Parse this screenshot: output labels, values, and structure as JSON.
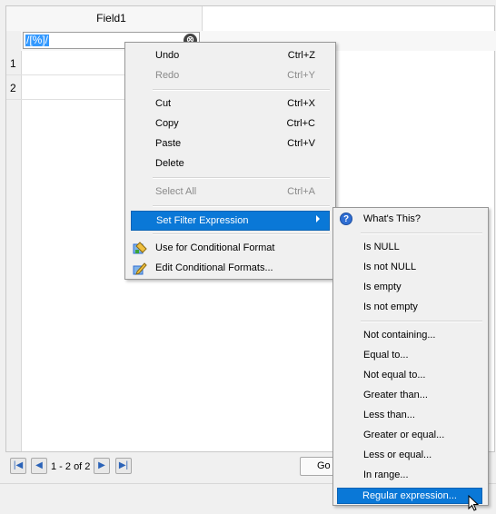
{
  "table": {
    "column_header": "Field1",
    "filter_value": "/[%]/",
    "clear_glyph": "⊗",
    "rows": [
      {
        "number": "1"
      },
      {
        "number": "2"
      }
    ]
  },
  "navigation": {
    "record_label": "1 - 2 of 2",
    "go_label": "Go"
  },
  "context_menu": {
    "undo": {
      "label": "Undo",
      "shortcut": "Ctrl+Z"
    },
    "redo": {
      "label": "Redo",
      "shortcut": "Ctrl+Y"
    },
    "cut": {
      "label": "Cut",
      "shortcut": "Ctrl+X"
    },
    "copy": {
      "label": "Copy",
      "shortcut": "Ctrl+C"
    },
    "paste": {
      "label": "Paste",
      "shortcut": "Ctrl+V"
    },
    "delete": {
      "label": "Delete"
    },
    "select_all": {
      "label": "Select All",
      "shortcut": "Ctrl+A"
    },
    "set_filter": {
      "label": "Set Filter Expression"
    },
    "conditional_format": {
      "label": "Use for Conditional Format",
      "icon": "conditional-format-icon"
    },
    "edit_conditional": {
      "label": "Edit Conditional Formats...",
      "icon": "edit-format-icon"
    }
  },
  "submenu": {
    "whats_this": {
      "label": "What's This?",
      "icon": "help-icon"
    },
    "items_group1": [
      "Is NULL",
      "Is not NULL",
      "Is empty",
      "Is not empty"
    ],
    "items_group2": [
      "Not containing...",
      "Equal to...",
      "Not equal to...",
      "Greater than...",
      "Less than...",
      "Greater or equal...",
      "Less or equal...",
      "In range..."
    ],
    "regex": {
      "label": "Regular expression..."
    }
  },
  "colors": {
    "highlight": "#0a78d7",
    "selection": "#3399ff"
  }
}
